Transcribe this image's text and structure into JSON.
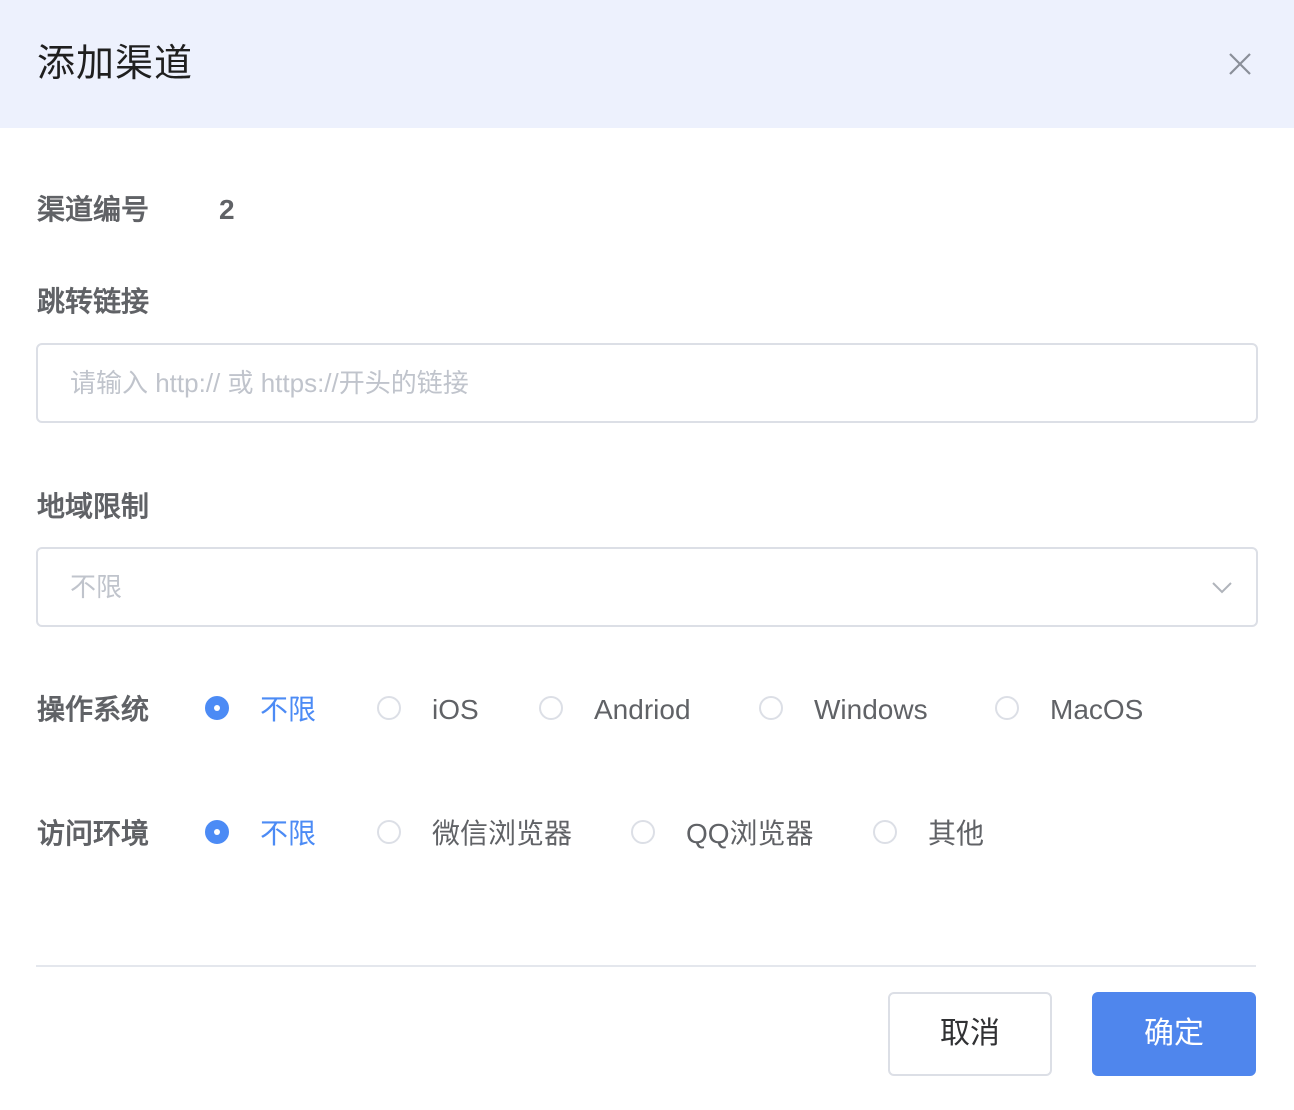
{
  "dialog": {
    "title": "添加渠道",
    "close_icon": "close-icon"
  },
  "form": {
    "channel_no": {
      "label": "渠道编号",
      "value": "2"
    },
    "redirect_link": {
      "label": "跳转链接",
      "placeholder": "请输入 http:// 或 https://开头的链接",
      "value": ""
    },
    "region": {
      "label": "地域限制",
      "selected": "不限",
      "icon": "chevron-down-icon"
    },
    "os": {
      "label": "操作系统",
      "options": [
        "不限",
        "iOS",
        "Andriod",
        "Windows",
        "MacOS"
      ],
      "selected": "不限"
    },
    "env": {
      "label": "访问环境",
      "options": [
        "不限",
        "微信浏览器",
        "QQ浏览器",
        "其他"
      ],
      "selected": "不限"
    }
  },
  "footer": {
    "cancel_label": "取消",
    "ok_label": "确定"
  },
  "colors": {
    "header_bg": "#edf1fd",
    "accent": "#4c8bf5",
    "primary_button": "#4f86ed"
  }
}
